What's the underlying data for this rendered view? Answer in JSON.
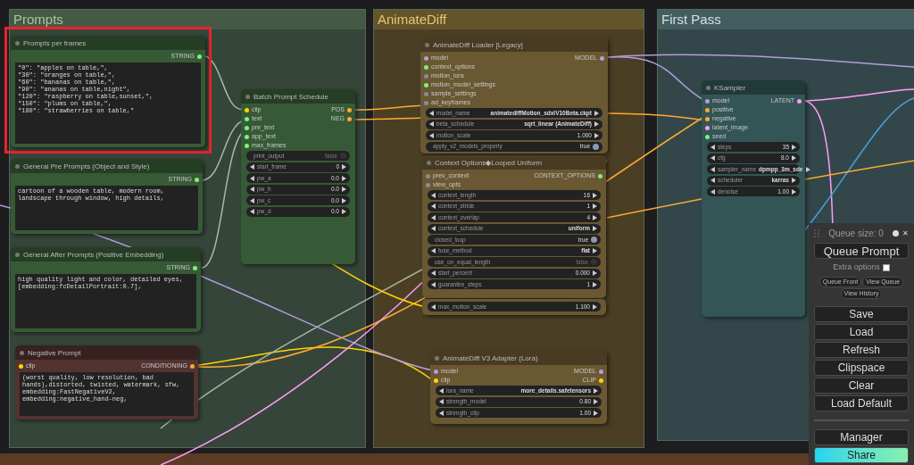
{
  "groups": [
    {
      "title": "Prompts",
      "color": "#35453a"
    },
    {
      "title": "AnimateDiff",
      "color": "#4a3f24"
    },
    {
      "title": "First Pass",
      "color": "#33474a"
    }
  ],
  "nodes": [
    {
      "kind": "text",
      "color": "#375a36",
      "title": "Prompts per frames",
      "highlighted": true,
      "outputs": [
        {
          "name": "STRING",
          "color": "#7cf27c"
        }
      ],
      "text": "\"0\": \"apples on table,\",\n\"30\": \"oranges on table,\",\n\"60\": \"bananas on table,\",\n\"90\": \"ananas on table,night\",\n\"120\": \"raspberry on table,sunset,\",\n\"150\": \"plums on table,\",\n\"180\": \"strawberries on table,\""
    },
    {
      "kind": "text",
      "color": "#375a36",
      "title": "General Pre Prompts (Object and Style)",
      "outputs": [
        {
          "name": "STRING",
          "color": "#7cf27c"
        }
      ],
      "text": "cartoon of a wooden table, modern room, landscape through window, high details,"
    },
    {
      "kind": "text",
      "color": "#375a36",
      "title": "General After Prompts (Positive Embedding)",
      "outputs": [
        {
          "name": "STRING",
          "color": "#7cf27c"
        }
      ],
      "text": "high quality light and color, detailed eyes,\n[embedding:fcDetailPortrait:0.7],"
    },
    {
      "kind": "text",
      "color": "#533331",
      "title": "Negative Prompt",
      "inputs": [
        {
          "name": "clip",
          "color": "#ffd500"
        }
      ],
      "outputs": [
        {
          "name": "CONDITIONING",
          "color": "#ffa931"
        }
      ],
      "text": "(worst quality, low resolution, bad hands),distorted, twisted, watermark, sfw, embedding:FastNegativeV2, embedding:negative_hand-neg,"
    },
    {
      "kind": "standard",
      "color": "#375a36",
      "title": "Batch Prompt Schedule",
      "inputs": [
        {
          "name": "clip",
          "color": "#ffd500"
        },
        {
          "name": "text",
          "color": "#7cf27c"
        },
        {
          "name": "pre_text",
          "color": "#7cf27c"
        },
        {
          "name": "app_text",
          "color": "#7cf27c"
        },
        {
          "name": "max_frames",
          "color": "#7cf27c"
        }
      ],
      "outputs": [
        {
          "name": "POS",
          "color": "#ffa931"
        },
        {
          "name": "NEG",
          "color": "#ffa931"
        }
      ],
      "widgets": [
        {
          "kind": "toggle",
          "name": "print_output",
          "value": "false",
          "on": false
        },
        {
          "kind": "number",
          "name": "start_frame",
          "value": "0"
        },
        {
          "kind": "number",
          "name": "pw_a",
          "value": "0.0"
        },
        {
          "kind": "number",
          "name": "pw_b",
          "value": "0.0"
        },
        {
          "kind": "number",
          "name": "pw_c",
          "value": "0.0"
        },
        {
          "kind": "number",
          "name": "pw_d",
          "value": "0.0"
        }
      ]
    },
    {
      "kind": "standard",
      "color": "#6a5833",
      "title": "AnimateDiff Loader [Legacy]",
      "inputs": [
        {
          "name": "model",
          "color": "#b39ddb"
        },
        {
          "name": "context_options",
          "color": "#7cf27c"
        },
        {
          "name": "motion_lora",
          "color": "#8a8a9a"
        },
        {
          "name": "motion_model_settings",
          "color": "#7cf27c"
        },
        {
          "name": "sample_settings",
          "color": "#8a8a9a"
        },
        {
          "name": "ad_keyframes",
          "color": "#8a8a9a"
        }
      ],
      "outputs": [
        {
          "name": "MODEL",
          "color": "#b39ddb"
        }
      ],
      "widgets": [
        {
          "kind": "combo",
          "name": "model_name",
          "value": "animatediffMotion_sdxlV10Beta.ckpt"
        },
        {
          "kind": "combo",
          "name": "beta_schedule",
          "value": "sqrt_linear (AnimateDiff)"
        },
        {
          "kind": "number",
          "name": "motion_scale",
          "value": "1.000"
        },
        {
          "kind": "toggle",
          "name": "apply_v2_models_properly",
          "value": "true",
          "on": true
        }
      ]
    },
    {
      "kind": "standard",
      "color": "#6a5833",
      "title": "Context Options◆Looped Uniform",
      "inputs": [
        {
          "name": "prev_context",
          "color": "#8a8a9a"
        },
        {
          "name": "view_opts",
          "color": "#8a8a9a"
        }
      ],
      "outputs": [
        {
          "name": "CONTEXT_OPTIONS",
          "color": "#7cf27c"
        }
      ],
      "widgets": [
        {
          "kind": "number",
          "name": "context_length",
          "value": "16"
        },
        {
          "kind": "number",
          "name": "context_stride",
          "value": "1"
        },
        {
          "kind": "number",
          "name": "context_overlap",
          "value": "4"
        },
        {
          "kind": "combo",
          "name": "context_schedule",
          "value": "uniform"
        },
        {
          "kind": "toggle",
          "name": "closed_loop",
          "value": "true",
          "on": true
        },
        {
          "kind": "combo",
          "name": "fuse_method",
          "value": "flat"
        },
        {
          "kind": "toggle",
          "name": "use_on_equal_length",
          "value": "false",
          "on": false
        },
        {
          "kind": "number",
          "name": "start_percent",
          "value": "0.000"
        },
        {
          "kind": "number",
          "name": "guarantee_steps",
          "value": "1"
        }
      ]
    },
    {
      "kind": "partial",
      "color": "#6a5833",
      "widgets": [
        {
          "kind": "number",
          "name": "max_motion_scale",
          "value": "1.100"
        }
      ]
    },
    {
      "kind": "standard",
      "color": "#6a5833",
      "title": "AnimateDiff V3 Adapter (Lora)",
      "inputs": [
        {
          "name": "model",
          "color": "#b39ddb"
        },
        {
          "name": "clip",
          "color": "#ffd500"
        }
      ],
      "outputs": [
        {
          "name": "MODEL",
          "color": "#b39ddb"
        },
        {
          "name": "CLIP",
          "color": "#ffd500"
        }
      ],
      "widgets": [
        {
          "kind": "combo",
          "name": "lora_name",
          "value": "more_details.safetensors"
        },
        {
          "kind": "number",
          "name": "strength_model",
          "value": "0.80"
        },
        {
          "kind": "number",
          "name": "strength_clip",
          "value": "1.00"
        }
      ]
    },
    {
      "kind": "standard",
      "color": "#335555",
      "title": "KSampler",
      "inputs": [
        {
          "name": "model",
          "color": "#b39ddb"
        },
        {
          "name": "positive",
          "color": "#ffa931"
        },
        {
          "name": "negative",
          "color": "#ffa931"
        },
        {
          "name": "latent_image",
          "color": "#ff9cf9"
        },
        {
          "name": "seed",
          "color": "#7cf27c"
        }
      ],
      "outputs": [
        {
          "name": "LATENT",
          "color": "#ff9cf9"
        }
      ],
      "widgets": [
        {
          "kind": "number",
          "name": "steps",
          "value": "35"
        },
        {
          "kind": "number",
          "name": "cfg",
          "value": "8.0"
        },
        {
          "kind": "combo",
          "name": "sampler_name",
          "value": "dpmpp_3m_sde"
        },
        {
          "kind": "combo",
          "name": "scheduler",
          "value": "karras"
        },
        {
          "kind": "number",
          "name": "denoise",
          "value": "1.00"
        }
      ]
    }
  ],
  "menu": {
    "queue_size": "Queue size: 0",
    "close": "✕",
    "queue_button": "Queue Prompt",
    "extra_options": "Extra options",
    "extra_checked": false,
    "small_buttons": [
      "Queue Front",
      "View Queue",
      "View History"
    ],
    "buttons": [
      "Save",
      "Load",
      "Refresh",
      "Clipspace",
      "Clear",
      "Load Default"
    ],
    "bottom_buttons": [
      {
        "label": "Manager",
        "kind": "plain"
      },
      {
        "label": "Share",
        "kind": "gradient"
      }
    ]
  }
}
